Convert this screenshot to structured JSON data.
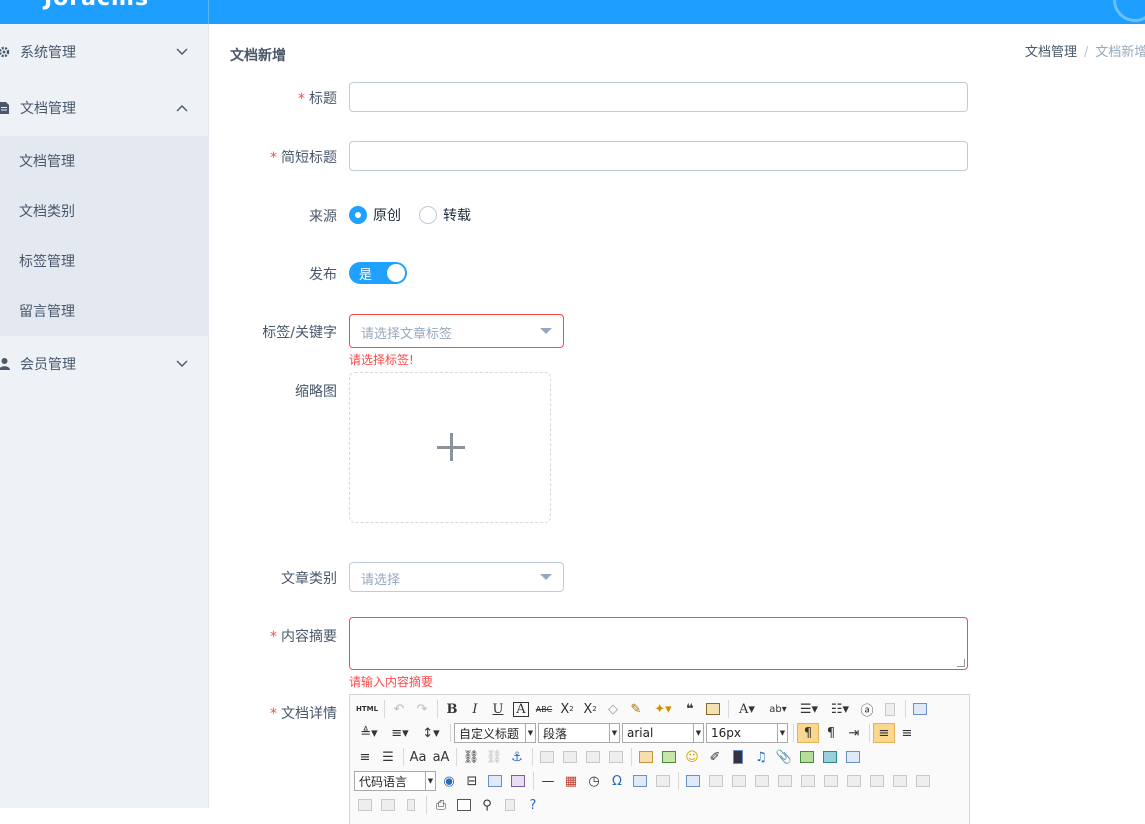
{
  "header": {
    "logo": "Joracms"
  },
  "sidebar": {
    "items": [
      {
        "label": "系统管理",
        "icon": "gear-icon"
      },
      {
        "label": "文档管理",
        "icon": "document-icon"
      },
      {
        "label": "会员管理",
        "icon": "user-icon"
      }
    ],
    "submenu": [
      {
        "label": "文档管理"
      },
      {
        "label": "文档类别"
      },
      {
        "label": "标签管理"
      },
      {
        "label": "留言管理"
      }
    ]
  },
  "main": {
    "title": "文档新增",
    "breadcrumb": [
      "文档管理",
      "文档新增"
    ]
  },
  "form": {
    "title_label": "标题",
    "short_title_label": "简短标题",
    "source_label": "来源",
    "source_options": [
      "原创",
      "转载"
    ],
    "source_selected": "原创",
    "publish_label": "发布",
    "publish_switch_text": "是",
    "tags_label": "标签/关键字",
    "tags_placeholder": "请选择文章标签",
    "tags_error": "请选择标签!",
    "thumbnail_label": "缩略图",
    "category_label": "文章类别",
    "category_placeholder": "请选择",
    "summary_label": "内容摘要",
    "summary_error": "请输入内容摘要",
    "detail_label": "文档详情",
    "required_mark": "*"
  },
  "editor": {
    "html_button": "HTML",
    "heading_select": "自定义标题",
    "paragraph_select": "段落",
    "font_select": "arial",
    "size_select": "16px",
    "code_lang_select": "代码语言"
  },
  "colors": {
    "header": "#1e9fff",
    "sidebar": "#eef1f6",
    "primary": "#20a0ff",
    "error": "#ff4949"
  }
}
